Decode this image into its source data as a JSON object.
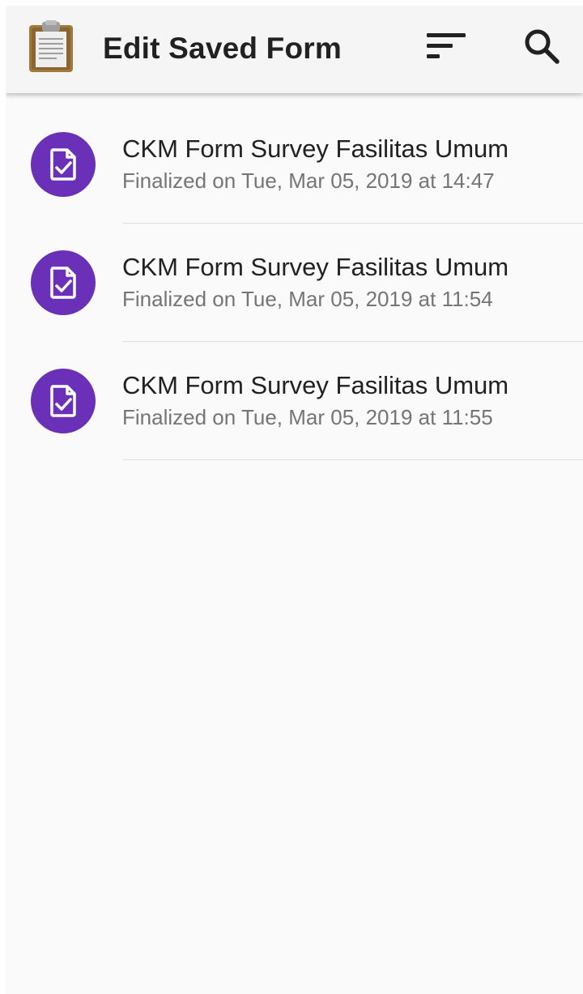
{
  "app_bar": {
    "title": "Edit Saved Form",
    "app_icon": "clipboard-icon",
    "actions": [
      {
        "name": "sort",
        "icon": "sort-icon"
      },
      {
        "name": "search",
        "icon": "search-icon"
      }
    ]
  },
  "forms": [
    {
      "title": "CKM Form Survey Fasilitas Umum",
      "status": "Finalized on Tue, Mar 05, 2019 at 14:47",
      "icon": "finalized-form-icon"
    },
    {
      "title": "CKM Form Survey Fasilitas Umum",
      "status": "Finalized on Tue, Mar 05, 2019 at 11:54",
      "icon": "finalized-form-icon"
    },
    {
      "title": "CKM Form Survey Fasilitas Umum",
      "status": "Finalized on Tue, Mar 05, 2019 at 11:55",
      "icon": "finalized-form-icon"
    }
  ],
  "colors": {
    "accent": "#6a31b8",
    "app_bar_bg": "#f5f5f5",
    "background": "#fafafa",
    "title_text": "#212121",
    "subtitle_text": "#757575"
  }
}
